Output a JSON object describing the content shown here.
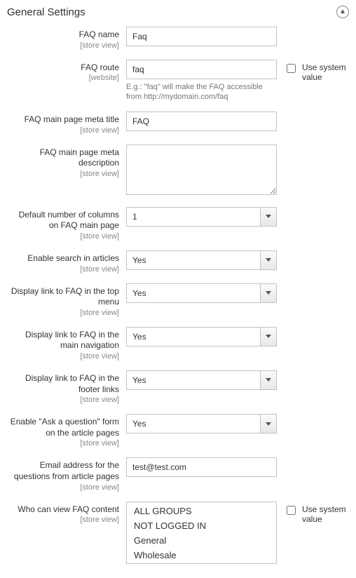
{
  "section": {
    "title": "General Settings"
  },
  "scopes": {
    "store_view": "[store view]",
    "website": "[website]"
  },
  "checkbox": {
    "use_system_value": "Use system value"
  },
  "fields": {
    "faq_name": {
      "label": "FAQ name",
      "value": "Faq"
    },
    "faq_route": {
      "label": "FAQ route",
      "value": "faq",
      "hint": "E.g.: \"faq\" will make the FAQ accessible from http://mydomain.com/faq"
    },
    "meta_title": {
      "label": "FAQ main page meta title",
      "value": "FAQ"
    },
    "meta_desc": {
      "label": "FAQ main page meta description",
      "value": ""
    },
    "columns": {
      "label": "Default number of columns on FAQ main page",
      "value": "1"
    },
    "enable_search": {
      "label": "Enable search in articles",
      "value": "Yes"
    },
    "link_top": {
      "label": "Display link to FAQ in the top menu",
      "value": "Yes"
    },
    "link_nav": {
      "label": "Display link to FAQ in the main navigation",
      "value": "Yes"
    },
    "link_footer": {
      "label": "Display link to FAQ in the footer links",
      "value": "Yes"
    },
    "ask_question": {
      "label": "Enable \"Ask a question\" form on the article pages",
      "value": "Yes"
    },
    "email": {
      "label": "Email address for the questions from article pages",
      "value": "test@test.com"
    },
    "who_view": {
      "label": "Who can view FAQ content",
      "options": [
        "ALL GROUPS",
        "NOT LOGGED IN",
        "General",
        "Wholesale"
      ]
    }
  }
}
